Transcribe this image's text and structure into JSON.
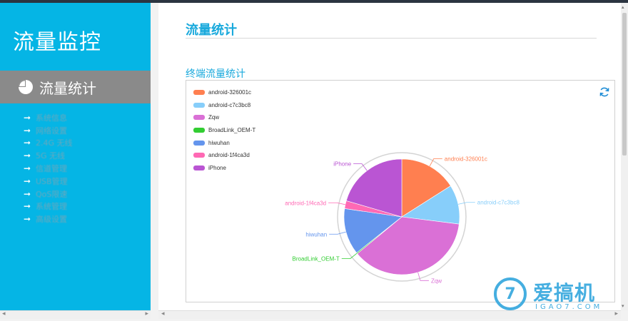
{
  "brand": "流量监控",
  "active_nav": {
    "label": "流量统计",
    "icon": "pie-chart-icon"
  },
  "menu": [
    {
      "label": "系统信息"
    },
    {
      "label": "网络设置"
    },
    {
      "label": "2.4G 无线"
    },
    {
      "label": "5G 无线"
    },
    {
      "label": "信道管理"
    },
    {
      "label": "USB管理"
    },
    {
      "label": "QoS限速"
    },
    {
      "label": "系统管理"
    },
    {
      "label": "高级设置"
    }
  ],
  "page_title": "流量统计",
  "section_title": "终端流量统计",
  "chart_data": {
    "type": "pie",
    "series": [
      {
        "name": "android-326001c",
        "value": 16,
        "color": "#ff7f50"
      },
      {
        "name": "android-c7c3bc8",
        "value": 11,
        "color": "#87cefa"
      },
      {
        "name": "Zqw",
        "value": 37,
        "color": "#da70d6"
      },
      {
        "name": "BroadLink_OEM-T",
        "value": 0.3,
        "color": "#32cd32"
      },
      {
        "name": "hiwuhan",
        "value": 13,
        "color": "#6495ed"
      },
      {
        "name": "android-1f4ca3d",
        "value": 2.2,
        "color": "#ff69b4"
      },
      {
        "name": "iPhone",
        "value": 20.5,
        "color": "#ba55d3"
      }
    ],
    "legend_position": "top-left"
  },
  "watermark": {
    "main": "爱搞机",
    "sub": "IGAO7.COM",
    "mark": "7"
  }
}
